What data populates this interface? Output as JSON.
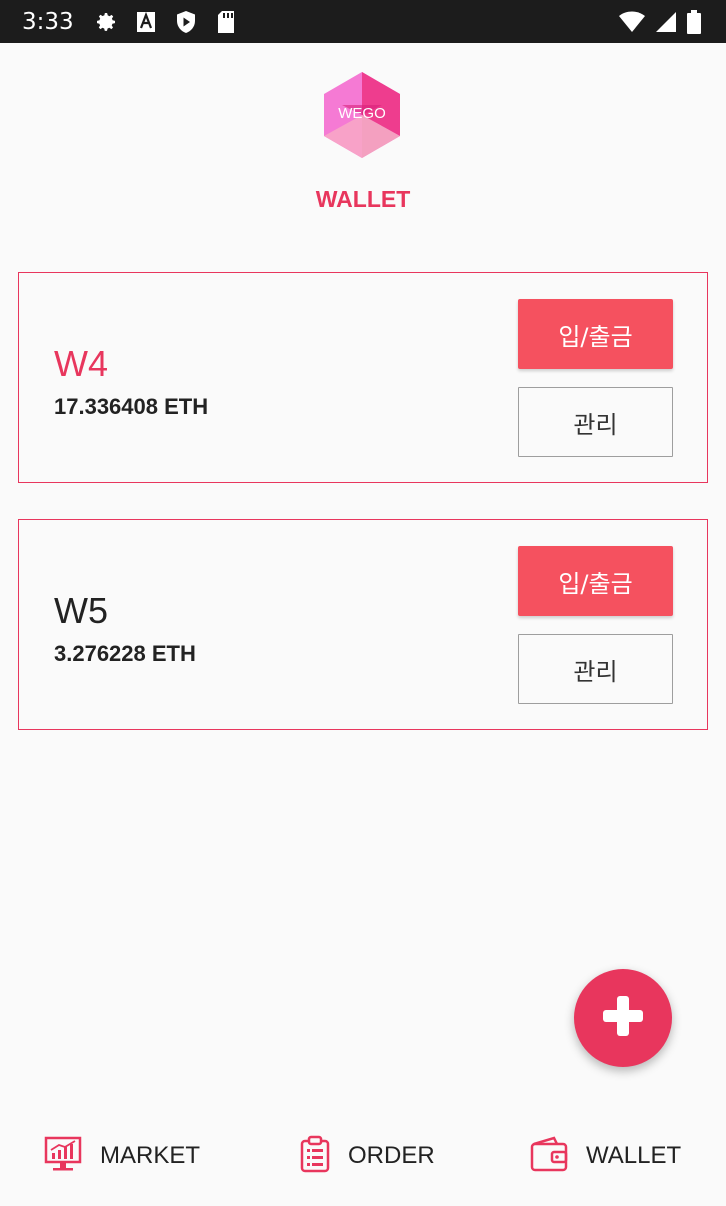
{
  "status_bar": {
    "time": "3:33",
    "left_icons": [
      "gear-icon",
      "font-a-icon",
      "play-shield-icon",
      "sd-card-icon"
    ],
    "right_icons": [
      "wifi-icon",
      "cell-signal-icon",
      "battery-icon"
    ]
  },
  "header": {
    "logo_text": "WEGO",
    "title": "WALLET"
  },
  "wallets": [
    {
      "name": "W4",
      "balance": "17.336408 ETH",
      "name_color": "#e8365d",
      "deposit_label": "입/출금",
      "manage_label": "관리"
    },
    {
      "name": "W5",
      "balance": "3.276228 ETH",
      "name_color": "#222222",
      "deposit_label": "입/출금",
      "manage_label": "관리"
    }
  ],
  "fab": {
    "icon": "plus-icon"
  },
  "bottom_nav": {
    "items": [
      {
        "label": "MARKET",
        "icon": "market-chart-icon"
      },
      {
        "label": "ORDER",
        "icon": "clipboard-list-icon"
      },
      {
        "label": "WALLET",
        "icon": "wallet-icon"
      }
    ]
  },
  "colors": {
    "accent": "#e8365d",
    "button": "#f5515f",
    "status_bar": "#1c1c1c"
  }
}
